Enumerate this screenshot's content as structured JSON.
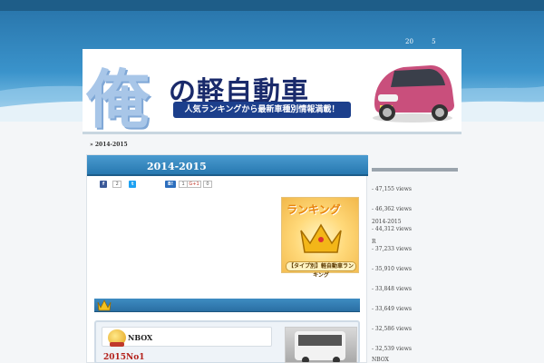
{
  "nav": {
    "item1": "20",
    "item2": "5"
  },
  "banner": {
    "big_char": "俺",
    "title": "の軽自動車",
    "tagline": "人気ランキングから最新車種別情報満載！"
  },
  "breadcrumb": "» 2014-2015",
  "post": {
    "title": "2014-2015",
    "share": {
      "fb_count": "2",
      "hb_count": "1",
      "gplus_label": "G+1",
      "gplus_count": "0"
    }
  },
  "ranking_image": {
    "title": "ランキング",
    "caption": "【タイプ別】軽自動車ランキング"
  },
  "entry": {
    "name": "NBOX",
    "year": "2015No1"
  },
  "sidebar": {
    "items": [
      {
        "label": "",
        "views": "- 47,155 views"
      },
      {
        "label": "",
        "views": "- 46,362 views"
      },
      {
        "label": "2014-2015",
        "views": "- 44,312 views"
      },
      {
        "label": "R",
        "views": "- 37,233 views"
      },
      {
        "label": "",
        "views": "- 35,910 views"
      },
      {
        "label": "",
        "views": "- 33,848 views"
      },
      {
        "label": "",
        "views": "- 33,649 views"
      },
      {
        "label": "",
        "views": "- 32,586 views"
      },
      {
        "label": "",
        "views": "- 32,539 views"
      },
      {
        "label": "NBOX",
        "views": ""
      }
    ]
  },
  "colors": {
    "header_blue": "#2a77ad",
    "heading_blue": "#2778b0",
    "accent_red": "#b3201a"
  }
}
